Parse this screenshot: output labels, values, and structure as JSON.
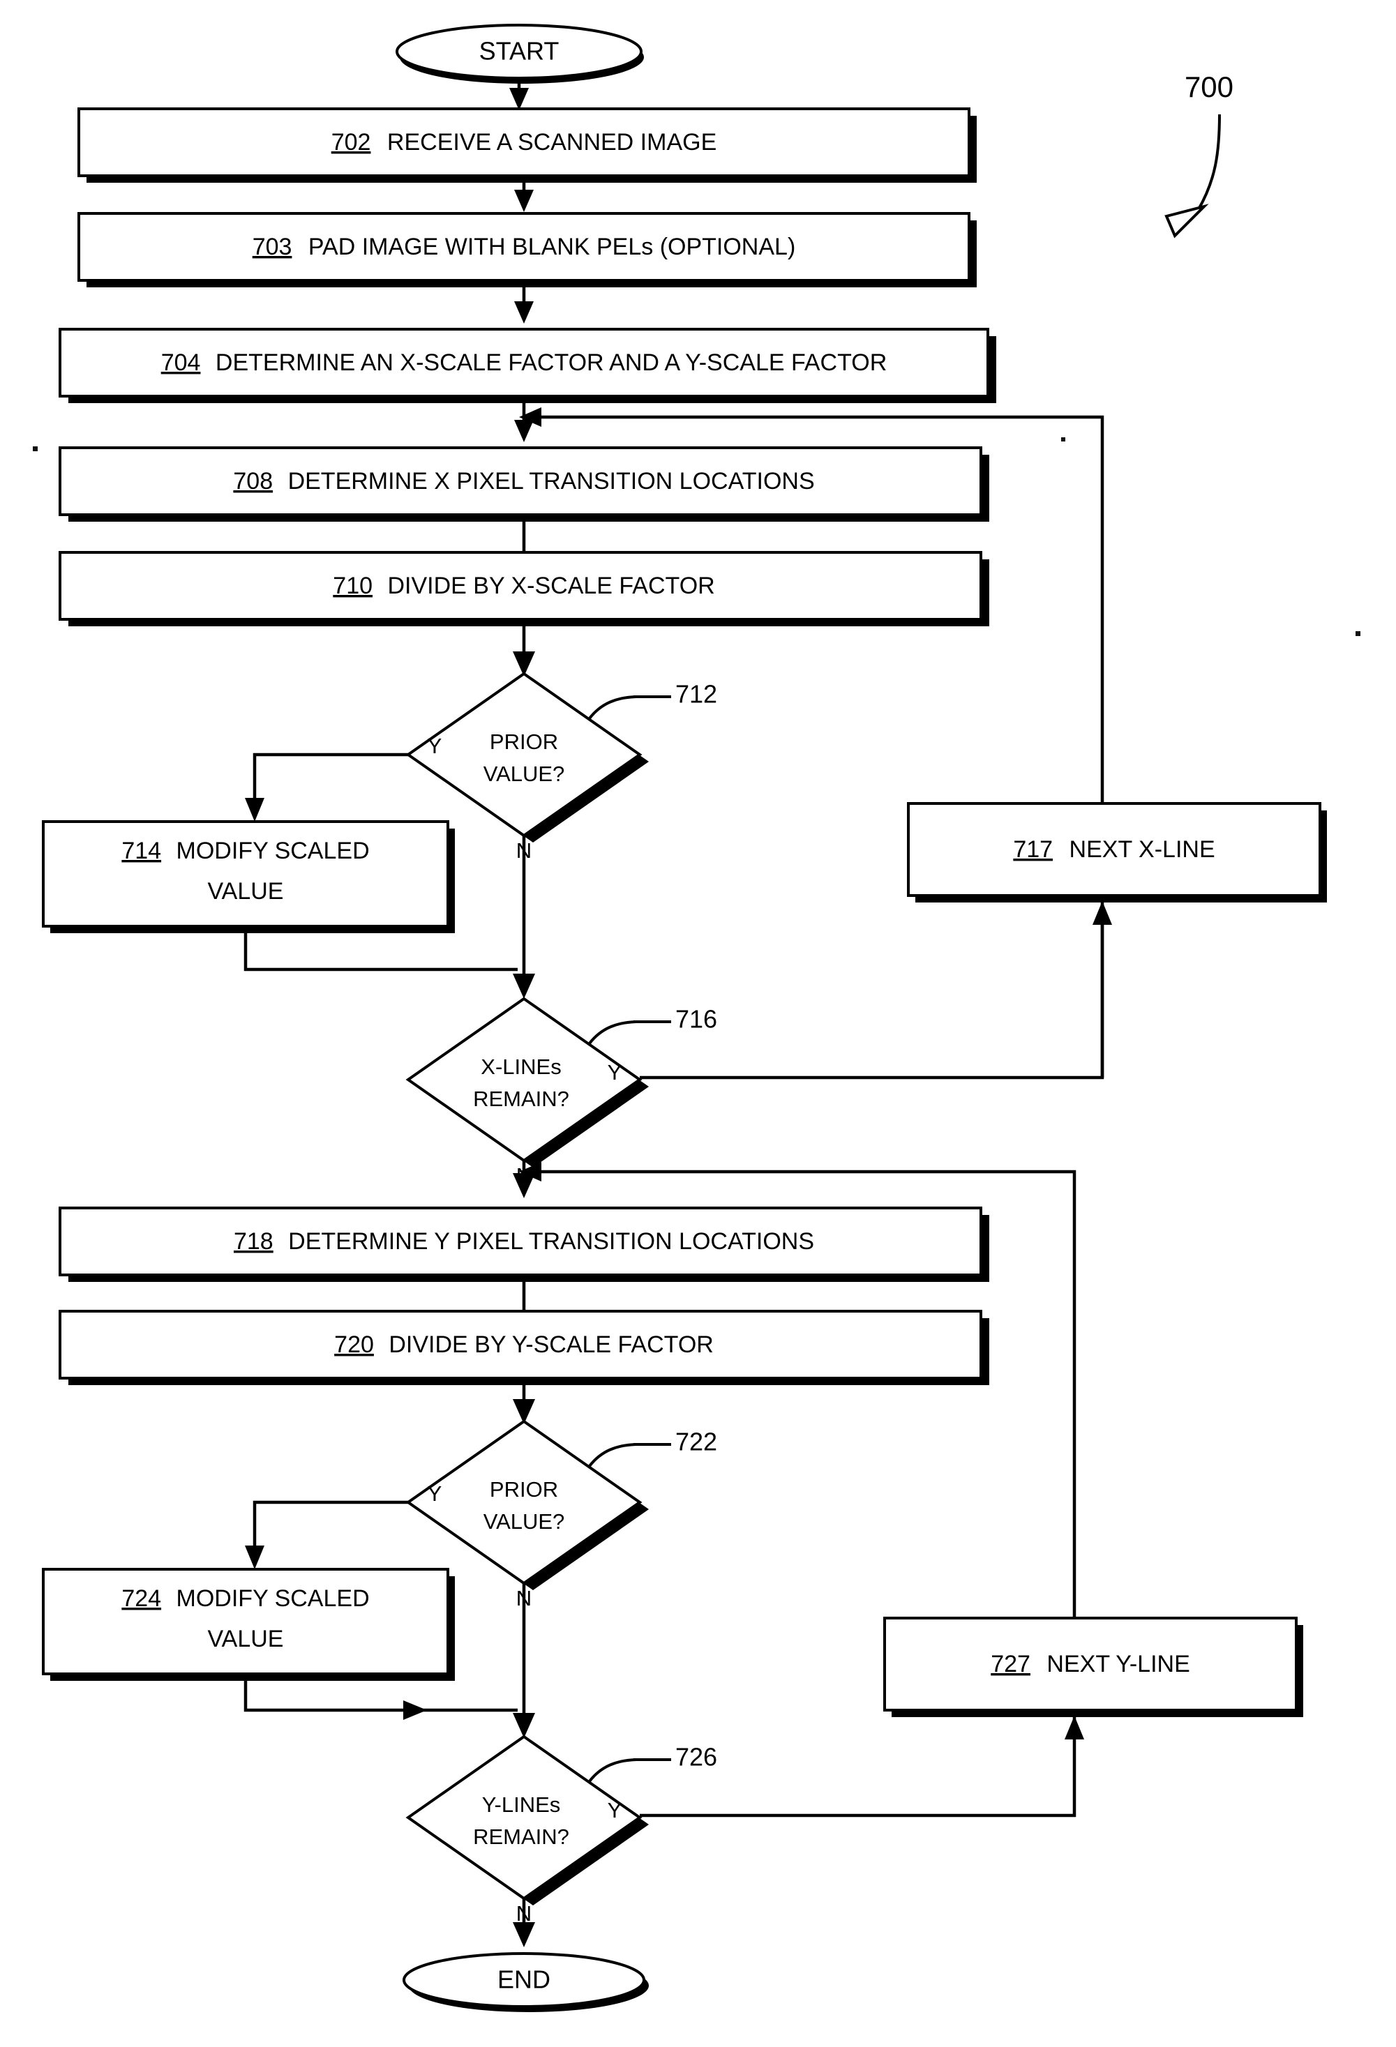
{
  "figure": {
    "label": "700",
    "type": "flowchart",
    "background_color": "#ffffff",
    "line_color": "#000000"
  },
  "terminals": [
    {
      "id": "start",
      "label": "START"
    },
    {
      "id": "end",
      "label": "END"
    }
  ],
  "process_boxes": [
    {
      "ref": "702",
      "text": "RECEIVE A SCANNED IMAGE"
    },
    {
      "ref": "703",
      "text": "PAD IMAGE WITH BLANK PELs (OPTIONAL)"
    },
    {
      "ref": "704",
      "text": "DETERMINE AN X-SCALE FACTOR AND A Y-SCALE FACTOR"
    },
    {
      "ref": "708",
      "text": "DETERMINE X  PIXEL TRANSITION LOCATIONS"
    },
    {
      "ref": "710",
      "text": "DIVIDE BY X-SCALE FACTOR"
    },
    {
      "ref": "714",
      "text": "MODIFY SCALED",
      "text2": "VALUE"
    },
    {
      "ref": "717",
      "text": "NEXT X-LINE"
    },
    {
      "ref": "718",
      "text": "DETERMINE Y  PIXEL TRANSITION LOCATIONS"
    },
    {
      "ref": "720",
      "text": "DIVIDE BY Y-SCALE FACTOR"
    },
    {
      "ref": "724",
      "text": "MODIFY SCALED",
      "text2": "VALUE"
    },
    {
      "ref": "727",
      "text": "NEXT Y-LINE"
    }
  ],
  "decisions": [
    {
      "ref": "712",
      "line1": "PRIOR",
      "line2": "VALUE?",
      "yes": "Y",
      "no": "N"
    },
    {
      "ref": "716",
      "line1": "X-LINEs",
      "line2": "REMAIN?",
      "yes": "Y",
      "no": "N"
    },
    {
      "ref": "722",
      "line1": "PRIOR",
      "line2": "VALUE?",
      "yes": "Y",
      "no": "N"
    },
    {
      "ref": "726",
      "line1": "Y-LINEs",
      "line2": "REMAIN?",
      "yes": "Y",
      "no": "N"
    }
  ]
}
